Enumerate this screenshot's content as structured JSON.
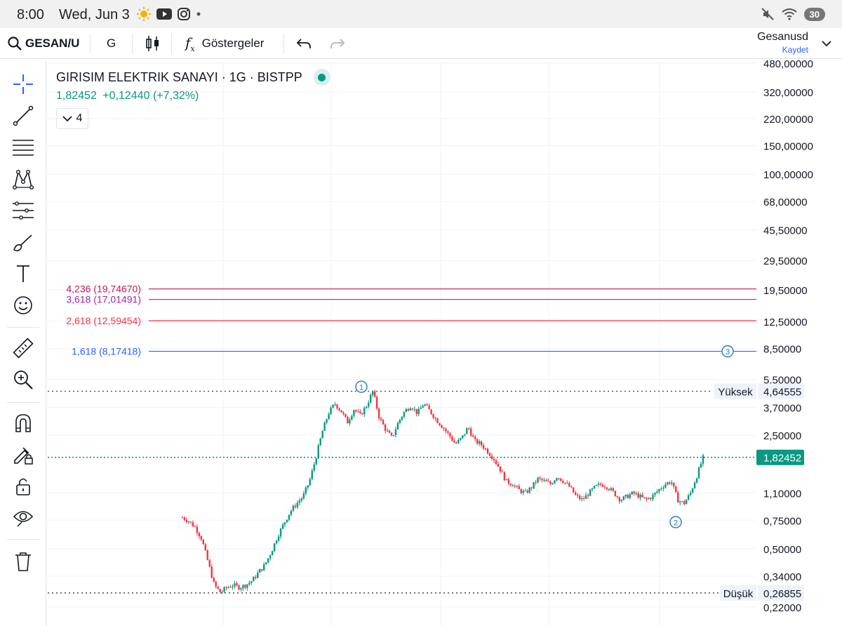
{
  "status_bar": {
    "time": "8:00",
    "date": "Wed, Jun 3",
    "battery": "30",
    "icons": [
      "weather-icon",
      "youtube-icon",
      "instagram-icon",
      "dot-icon",
      "mute-icon",
      "wifi-icon",
      "battery-icon"
    ]
  },
  "toolbar": {
    "symbol": "GESAN/US",
    "interval": "G",
    "indicators_label": "Göstergeler",
    "layout_name": "Gesanusd",
    "save_label": "Kaydet"
  },
  "left_tools": [
    "crosshair-icon",
    "trend-line-icon",
    "fib-retracement-icon",
    "pattern-icon",
    "forecast-icon",
    "brush-icon",
    "text-icon",
    "emoji-icon",
    "ruler-icon",
    "zoom-icon",
    "magnet-icon",
    "lock-drawing-icon",
    "lock-icon",
    "eye-icon",
    "trash-icon"
  ],
  "legend": {
    "title": "GIRISIM ELEKTRIK SANAYI · 1G · BISTPP",
    "last": "1,82452",
    "change": "+0,12440",
    "change_pct": "(+7,32%)",
    "collapsed_count": "4"
  },
  "colors": {
    "up": "#089981",
    "down": "#f23645",
    "fib_4236": "#c2185b",
    "fib_3618": "#9c27b0",
    "fib_2618": "#f23645",
    "fib_1618": "#2962ff",
    "last_price_bg": "#089981"
  },
  "chart_data": {
    "type": "candlestick",
    "y_scale": "log",
    "ylim": [
      0.2,
      520
    ],
    "grid": true,
    "y_ticks": [
      {
        "value": 480,
        "label": "480,00000"
      },
      {
        "value": 320,
        "label": "320,00000"
      },
      {
        "value": 220,
        "label": "220,00000"
      },
      {
        "value": 150,
        "label": "150,00000"
      },
      {
        "value": 100,
        "label": "100,00000"
      },
      {
        "value": 68,
        "label": "68,00000"
      },
      {
        "value": 45.5,
        "label": "45,50000"
      },
      {
        "value": 29.5,
        "label": "29,50000"
      },
      {
        "value": 19.5,
        "label": "19,50000"
      },
      {
        "value": 12.5,
        "label": "12,50000"
      },
      {
        "value": 8.5,
        "label": "8,50000"
      },
      {
        "value": 5.5,
        "label": "5,50000"
      },
      {
        "value": 3.7,
        "label": "3,70000"
      },
      {
        "value": 2.5,
        "label": "2,50000"
      },
      {
        "value": 1.1,
        "label": "1,10000"
      },
      {
        "value": 0.75,
        "label": "0,75000"
      },
      {
        "value": 0.5,
        "label": "0,50000"
      },
      {
        "value": 0.34,
        "label": "0,34000"
      },
      {
        "value": 0.22,
        "label": "0,22000"
      }
    ],
    "fib_levels": [
      {
        "label": "4,236 (19,74670)",
        "value": 19.7467,
        "color": "#c2185b"
      },
      {
        "label": "3,618 (17,01491)",
        "value": 17.01491,
        "color": "#9c27b0"
      },
      {
        "label": "2,618 (12,59454)",
        "value": 12.59454,
        "color": "#f23645"
      },
      {
        "label": "1,618 (8,17418)",
        "value": 8.17418,
        "color": "#2962ff"
      }
    ],
    "high_line": {
      "label": "Yüksek",
      "value": 4.64555,
      "value_label": "4,64555"
    },
    "low_line": {
      "label": "Düşük",
      "value": 0.26855,
      "value_label": "0,26855"
    },
    "last_price": {
      "value": 1.82452,
      "value_label": "1,82452"
    },
    "wave_labels": [
      {
        "text": "1",
        "value": 4.95
      },
      {
        "text": "2",
        "value": 0.73
      },
      {
        "text": "3",
        "value": 8.17
      }
    ],
    "price_path": [
      0.78,
      0.74,
      0.68,
      0.58,
      0.42,
      0.3,
      0.27,
      0.29,
      0.3,
      0.29,
      0.3,
      0.32,
      0.36,
      0.4,
      0.48,
      0.6,
      0.72,
      0.85,
      0.95,
      1.05,
      1.3,
      1.8,
      2.6,
      3.4,
      3.9,
      3.5,
      3.0,
      3.6,
      3.3,
      3.8,
      4.65,
      3.2,
      2.7,
      2.4,
      3.0,
      3.5,
      3.8,
      3.4,
      3.9,
      3.5,
      3.1,
      2.8,
      2.5,
      2.2,
      2.4,
      2.8,
      2.3,
      2.2,
      2.0,
      1.8,
      1.55,
      1.3,
      1.25,
      1.15,
      1.1,
      1.2,
      1.35,
      1.3,
      1.25,
      1.4,
      1.3,
      1.2,
      1.05,
      1.0,
      1.1,
      1.2,
      1.25,
      1.2,
      1.1,
      1.0,
      1.05,
      1.1,
      1.05,
      1.0,
      1.05,
      1.15,
      1.25,
      1.3,
      1.0,
      0.95,
      1.1,
      1.4,
      1.82
    ]
  }
}
